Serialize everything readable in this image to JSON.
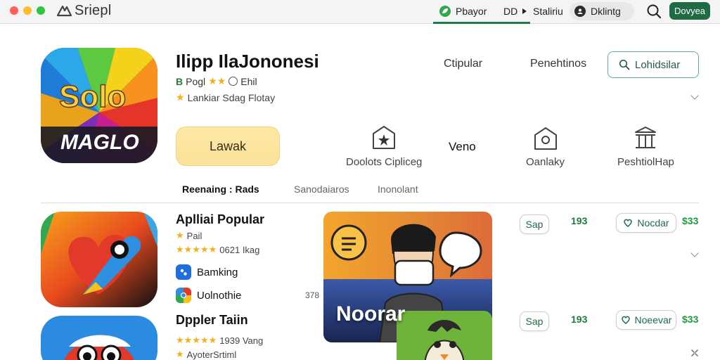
{
  "window": {
    "title": "Sriepl"
  },
  "top_nav": {
    "play_label": "Pbayor",
    "dp_label": "DD",
    "sta_label": "Staliriu",
    "pill_label": "Dklintg",
    "button_label": "Dovyea"
  },
  "hero": {
    "title": "Ilipp IlaJononesi",
    "sub1_text": "Pogl",
    "sub1_extra": "Ehil",
    "sub2_text": "Lankiar Sdag Flotay",
    "install_label": "Lawak",
    "features": {
      "a_label": "Doolots Cipliceg",
      "b_label": "Veno",
      "c_label": "Oanlaky",
      "d_label": "PeshtiolHap"
    },
    "header_links": {
      "link_a": "Ctipular",
      "link_b": "Penehtinos",
      "search_label": "Lohidsilar"
    },
    "tabs": {
      "tab_a": "Reenaing : Rads",
      "tab_b": "Sanodaiaros",
      "tab_c": "Inonolant"
    }
  },
  "list": {
    "row1": {
      "title": "Aplliai Popular",
      "sub1": "Pail",
      "sub2": "0621 Ikag",
      "item1_label": "Bamking",
      "item2_label": "Uolnothie",
      "side_num": "378",
      "chip_sap": "Sap",
      "num_a": "193",
      "chip_nd": "Nocdar",
      "num_b": "$33"
    },
    "row2": {
      "title": "Dppler Taiin",
      "sub1": "1939 Vang",
      "sub2": "AyoterSrtiml",
      "chip_sap": "Sap",
      "num_a": "193",
      "chip_nd": "Noeevar",
      "num_b": "$33"
    },
    "banner_text": "Noorar"
  },
  "colors": {
    "accent_green": "#1f6b45",
    "star_yellow": "#f2b01e",
    "install_yellow": "#fbe29a"
  }
}
